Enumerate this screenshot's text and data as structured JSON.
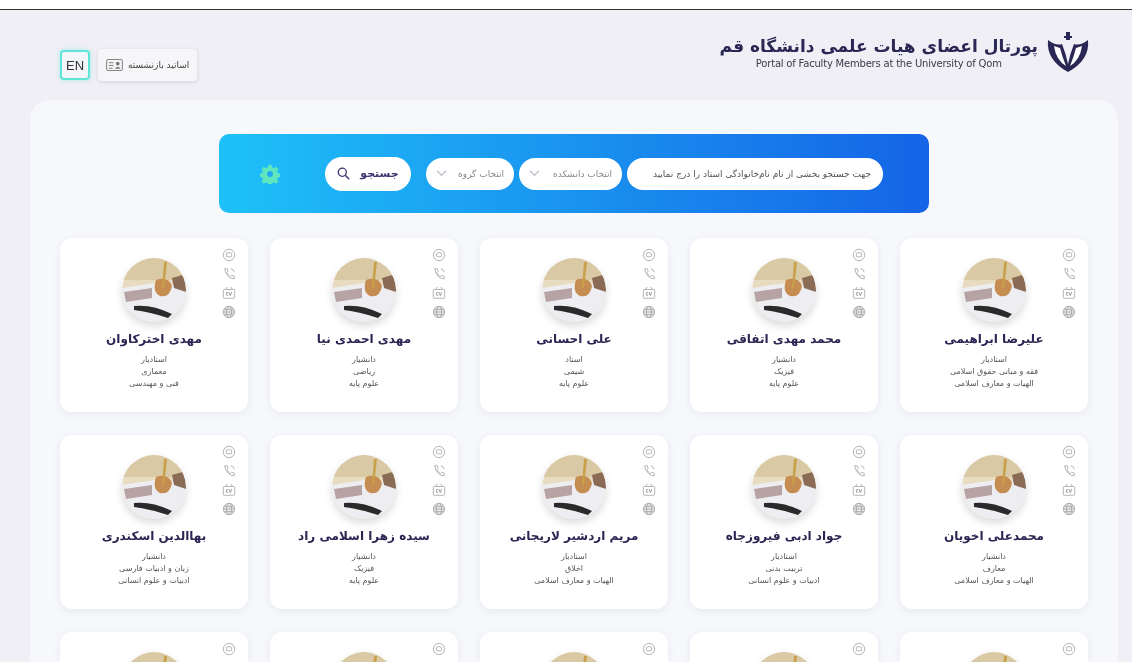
{
  "header": {
    "title": "پورتال اعضای هیات علمی دانشگاه قم",
    "subtitle": "Portal of Faculty Members at the University of Qom",
    "retired_button": "اساتید بازنشسته",
    "language_button": "EN"
  },
  "search": {
    "placeholder": "جهت جستجو بخشی از نام نام‌خانوادگی استاد را درج نمایید",
    "faculty_select": "انتخاب دانشکده",
    "group_select": "انتخاب گروه",
    "button": "جستجو"
  },
  "cards": [
    {
      "kind": "full",
      "name": "علیرضا ابراهیمی",
      "rank": "استادیار",
      "department": "فقه و مبانی حقوق اسلامی",
      "faculty": "الهیات و معارف اسلامی"
    },
    {
      "kind": "full",
      "name": "محمد مهدی اتفاقی",
      "rank": "دانشیار",
      "department": "فیزیک",
      "faculty": "علوم پایه"
    },
    {
      "kind": "full",
      "name": "علی احسانی",
      "rank": "استاد",
      "department": "شیمی",
      "faculty": "علوم پایه"
    },
    {
      "kind": "full",
      "name": "مهدی احمدی نیا",
      "rank": "دانشیار",
      "department": "ریاضی",
      "faculty": "علوم پایه"
    },
    {
      "kind": "full",
      "name": "مهدی اخترکاوان",
      "rank": "استادیار",
      "department": "معماری",
      "faculty": "فنی و مهندسی"
    },
    {
      "kind": "full",
      "name": "محمدعلی اخویان",
      "rank": "دانشیار",
      "department": "معارف",
      "faculty": "الهیات و معارف اسلامی"
    },
    {
      "kind": "full",
      "name": "جواد ادبی فیروزجاه",
      "rank": "استادیار",
      "department": "تربیت بدنی",
      "faculty": "ادبیات و علوم انسانی"
    },
    {
      "kind": "full",
      "name": "مریم اردشیر لاریجانی",
      "rank": "استادیار",
      "department": "اخلاق",
      "faculty": "الهیات و معارف اسلامی"
    },
    {
      "kind": "full",
      "name": "سیده زهرا اسلامی راد",
      "rank": "دانشیار",
      "department": "فیزیک",
      "faculty": "علوم پایه"
    },
    {
      "kind": "full",
      "name": "بهاالدین اسکندری",
      "rank": "دانشیار",
      "department": "زبان و ادبیات فارسی",
      "faculty": "ادبیات و علوم انسانی"
    },
    {
      "kind": "partial"
    },
    {
      "kind": "partial"
    },
    {
      "kind": "partial"
    },
    {
      "kind": "partial"
    },
    {
      "kind": "partial"
    }
  ]
}
